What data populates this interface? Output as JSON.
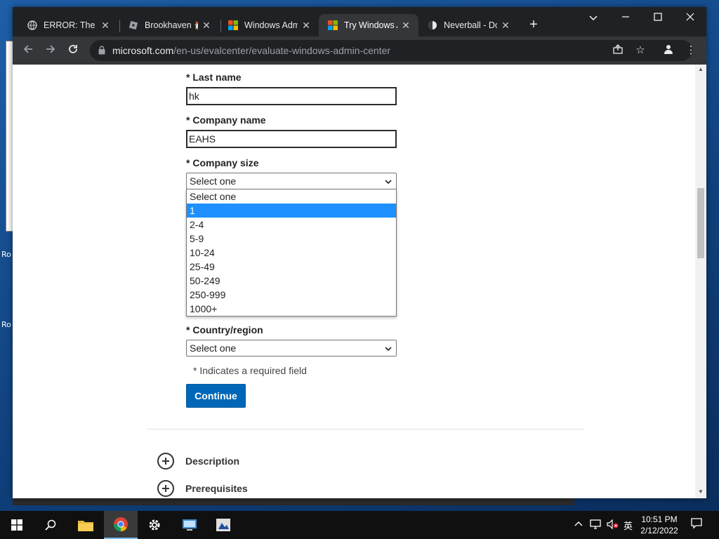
{
  "desktop": {
    "labels": [
      "Ro",
      "Ro"
    ]
  },
  "browser": {
    "tabs": [
      {
        "title": "ERROR: The re",
        "icon": "globe-icon"
      },
      {
        "title": "Brookhaven 🏠",
        "icon": "roblox-icon"
      },
      {
        "title": "Windows Adm",
        "icon": "microsoft-logo-icon"
      },
      {
        "title": "Try Windows A",
        "icon": "microsoft-logo-icon",
        "active": true
      },
      {
        "title": "Neverball - Do",
        "icon": "neverball-icon"
      }
    ],
    "url_host": "microsoft.com",
    "url_path": "/en-us/evalcenter/evaluate-windows-admin-center"
  },
  "form": {
    "last_name_label": "* Last name",
    "last_name_value": "hk",
    "company_name_label": "* Company name",
    "company_name_value": "EAHS",
    "company_size_label": "* Company size",
    "company_size_value": "Select one",
    "company_size_options": [
      "Select one",
      "1",
      "2-4",
      "5-9",
      "10-24",
      "25-49",
      "50-249",
      "250-999",
      "1000+"
    ],
    "company_size_highlighted": "1",
    "country_label": "* Country/region",
    "country_value": "Select one",
    "required_note": "* Indicates a required field",
    "continue_label": "Continue"
  },
  "sections": [
    {
      "label": "Description"
    },
    {
      "label": "Prerequisites"
    }
  ],
  "taskbar": {
    "time": "10:51 PM",
    "date": "2/12/2022",
    "ime": "英"
  },
  "colors": {
    "accent": "#0067b8",
    "highlight": "#1e90ff",
    "tab_bg": "#202124"
  }
}
